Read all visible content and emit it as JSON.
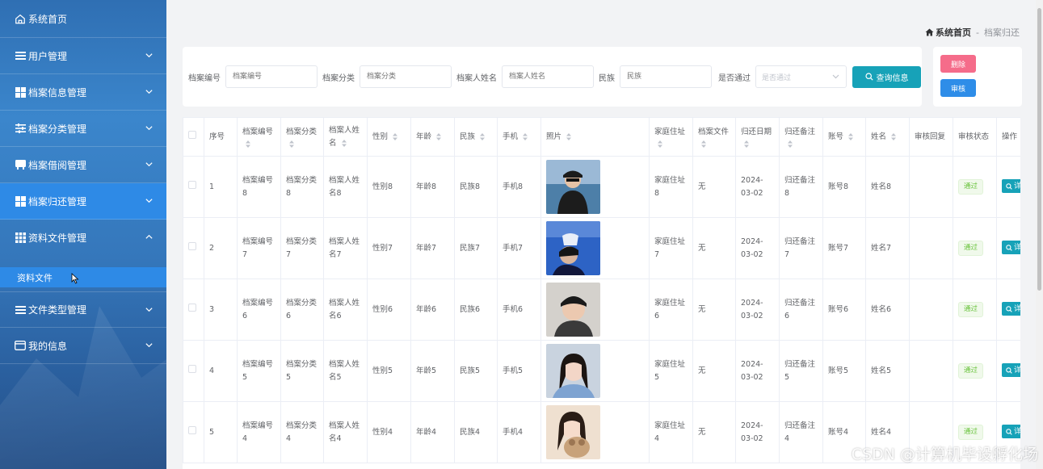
{
  "sidebar": {
    "home_label": "系统首页",
    "items": [
      {
        "label": "用户管理",
        "icon": "list-icon"
      },
      {
        "label": "档案信息管理",
        "icon": "grid-icon"
      },
      {
        "label": "档案分类管理",
        "icon": "sliders-icon"
      },
      {
        "label": "档案借阅管理",
        "icon": "book-icon"
      },
      {
        "label": "档案归还管理",
        "icon": "grid-icon"
      },
      {
        "label": "资料文件管理",
        "icon": "apps-icon"
      },
      {
        "label": "文件类型管理",
        "icon": "list-icon"
      },
      {
        "label": "我的信息",
        "icon": "card-icon"
      }
    ],
    "submenu_label": "资料文件"
  },
  "breadcrumb": {
    "home": "系统首页",
    "separator": "-",
    "current": "档案归还"
  },
  "search": {
    "fields": [
      {
        "label": "档案编号",
        "placeholder": "档案编号"
      },
      {
        "label": "档案分类",
        "placeholder": "档案分类"
      },
      {
        "label": "档案人姓名",
        "placeholder": "档案人姓名"
      },
      {
        "label": "民族",
        "placeholder": "民族"
      }
    ],
    "select_label": "是否通过",
    "select_placeholder": "是否通过",
    "query_label": "查询信息"
  },
  "actions": {
    "delete_label": "删除",
    "audit_label": "审核"
  },
  "table": {
    "headers": {
      "seq": "序号",
      "archive_no": "档案编号",
      "category": "档案分类",
      "person_name": "档案人姓名",
      "gender": "性别",
      "age": "年龄",
      "ethnicity": "民族",
      "phone": "手机",
      "photo": "照片",
      "address": "家庭住址",
      "file": "档案文件",
      "return_date": "归还日期",
      "return_note": "归还备注",
      "account": "账号",
      "name": "姓名",
      "audit_reply": "审核回复",
      "audit_status": "审核状态",
      "operation": "操作"
    },
    "rows": [
      {
        "seq": "1",
        "archive_no": "档案编号8",
        "category": "档案分类8",
        "person_name": "档案人姓名8",
        "gender": "性别8",
        "age": "年龄8",
        "ethnicity": "民族8",
        "phone": "手机8",
        "address": "家庭住址8",
        "file": "无",
        "return_date": "2024-03-02",
        "return_note": "归还备注8",
        "account": "账号8",
        "name": "姓名8",
        "audit_reply": "",
        "audit_status": "通过",
        "detail": "详"
      },
      {
        "seq": "2",
        "archive_no": "档案编号7",
        "category": "档案分类7",
        "person_name": "档案人姓名7",
        "gender": "性别7",
        "age": "年龄7",
        "ethnicity": "民族7",
        "phone": "手机7",
        "address": "家庭住址7",
        "file": "无",
        "return_date": "2024-03-02",
        "return_note": "归还备注7",
        "account": "账号7",
        "name": "姓名7",
        "audit_reply": "",
        "audit_status": "通过",
        "detail": "详"
      },
      {
        "seq": "3",
        "archive_no": "档案编号6",
        "category": "档案分类6",
        "person_name": "档案人姓名6",
        "gender": "性别6",
        "age": "年龄6",
        "ethnicity": "民族6",
        "phone": "手机6",
        "address": "家庭住址6",
        "file": "无",
        "return_date": "2024-03-02",
        "return_note": "归还备注6",
        "account": "账号6",
        "name": "姓名6",
        "audit_reply": "",
        "audit_status": "通过",
        "detail": "详"
      },
      {
        "seq": "4",
        "archive_no": "档案编号5",
        "category": "档案分类5",
        "person_name": "档案人姓名5",
        "gender": "性别5",
        "age": "年龄5",
        "ethnicity": "民族5",
        "phone": "手机5",
        "address": "家庭住址5",
        "file": "无",
        "return_date": "2024-03-02",
        "return_note": "归还备注5",
        "account": "账号5",
        "name": "姓名5",
        "audit_reply": "",
        "audit_status": "通过",
        "detail": "详"
      },
      {
        "seq": "5",
        "archive_no": "档案编号4",
        "category": "档案分类4",
        "person_name": "档案人姓名4",
        "gender": "性别4",
        "age": "年龄4",
        "ethnicity": "民族4",
        "phone": "手机4",
        "address": "家庭住址4",
        "file": "无",
        "return_date": "2024-03-02",
        "return_note": "归还备注4",
        "account": "账号4",
        "name": "姓名4",
        "audit_reply": "",
        "audit_status": "通过",
        "detail": "详"
      }
    ]
  },
  "watermark": "CSDN @计算机毕设孵化场",
  "colors": {
    "sidebar_active": "#2e8ae6",
    "query_button": "#17a2b8",
    "delete_button": "#f56c8a",
    "audit_button": "#2e8de8",
    "status_pass": "#67c23a"
  }
}
